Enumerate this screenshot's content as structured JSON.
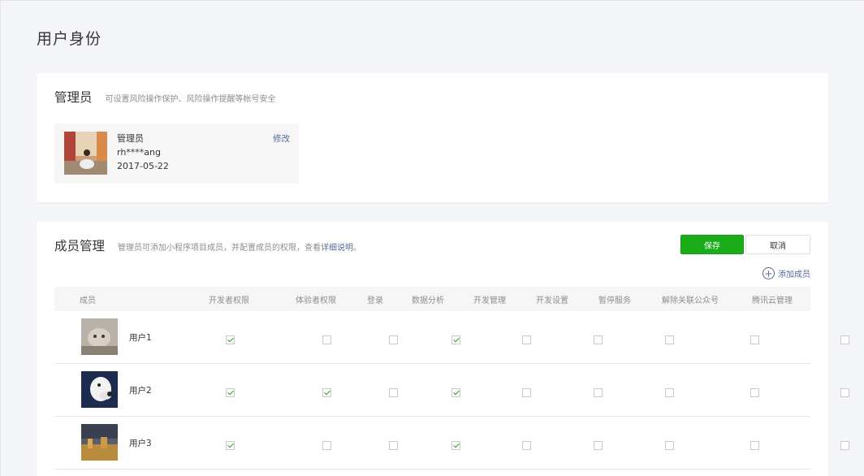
{
  "page": {
    "title": "用户身份"
  },
  "admin": {
    "title": "管理员",
    "desc": "可设置风险操作保护、风险操作提醒等帐号安全",
    "role": "管理员",
    "account": "rh****ang",
    "date": "2017-05-22",
    "edit_label": "修改"
  },
  "members": {
    "title": "成员管理",
    "desc_prefix": "管理员可添加小程序项目成员，并配置成员的权限，查看",
    "desc_link": "详细说明",
    "desc_suffix": "。",
    "save_label": "保存",
    "cancel_label": "取消",
    "add_label": "添加成员",
    "columns": [
      "成员",
      "开发者权限",
      "体验者权限",
      "登录",
      "数据分析",
      "开发管理",
      "开发设置",
      "暂停服务",
      "解除关联公众号",
      "腾讯云管理"
    ],
    "rows": [
      {
        "name": "用户1",
        "perms": [
          true,
          false,
          false,
          true,
          false,
          false,
          false,
          false,
          false
        ]
      },
      {
        "name": "用户2",
        "perms": [
          true,
          true,
          false,
          true,
          false,
          false,
          false,
          false,
          false
        ]
      },
      {
        "name": "用户3",
        "perms": [
          true,
          false,
          false,
          true,
          false,
          false,
          false,
          false,
          false
        ]
      }
    ]
  },
  "colors": {
    "accent": "#1aad19",
    "link": "#576b95",
    "bg": "#f4f5f9"
  }
}
